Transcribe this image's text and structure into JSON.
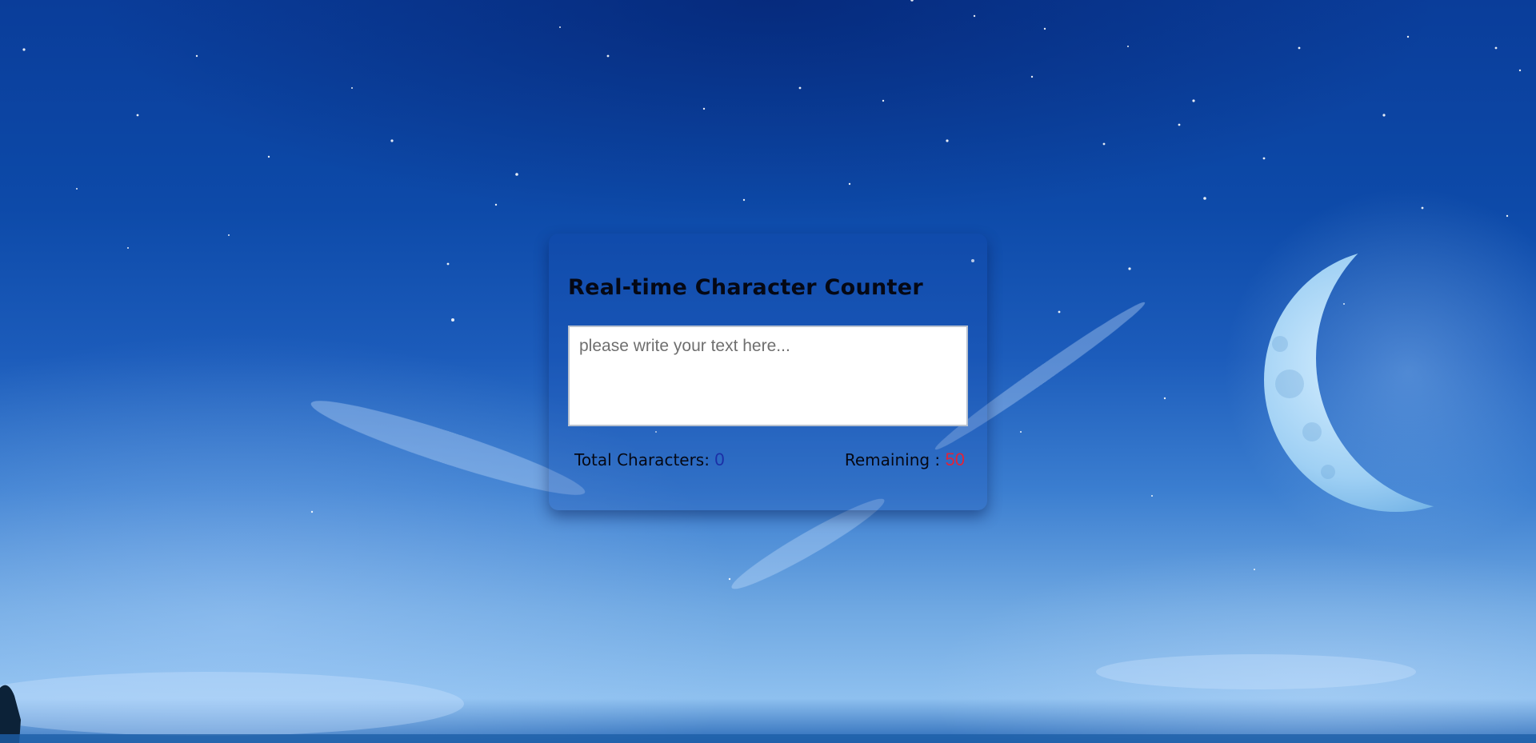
{
  "page": {
    "background_theme": "night sky with crescent moon",
    "colors": {
      "total_value": "#1b2fa6",
      "remaining_value": "#e0243a",
      "title": "#050814"
    }
  },
  "counter_card": {
    "title": "Real-time Character Counter",
    "textarea": {
      "value": "",
      "placeholder": "please write your text here..."
    },
    "total": {
      "label": "Total Characters: ",
      "value": "0"
    },
    "remaining": {
      "label": "Remaining : ",
      "value": "50"
    }
  }
}
